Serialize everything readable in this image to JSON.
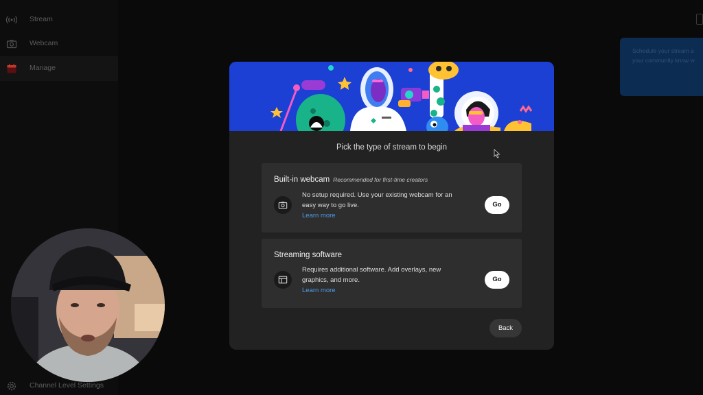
{
  "sidebar": {
    "items": [
      {
        "label": "Stream",
        "icon": "broadcast-icon"
      },
      {
        "label": "Webcam",
        "icon": "camera-icon"
      },
      {
        "label": "Manage",
        "icon": "calendar-icon"
      }
    ],
    "footer_label": "Channel Level Settings"
  },
  "promo": {
    "line1": "Schedule your stream a",
    "line2": "your community know w"
  },
  "modal": {
    "title": "Pick the type of stream to begin",
    "options": [
      {
        "title": "Built-in webcam",
        "tag": "Recommended for first-time creators",
        "desc_line1": "No setup required. Use your existing webcam for an",
        "desc_line2": "easy way to go live.",
        "link": "Learn more",
        "button": "Go",
        "icon": "camera-icon"
      },
      {
        "title": "Streaming software",
        "desc_line1": "Requires additional software. Add overlays, new",
        "desc_line2": "graphics, and more.",
        "link": "Learn more",
        "button": "Go",
        "icon": "layout-icon"
      }
    ],
    "back_label": "Back"
  },
  "colors": {
    "banner": "#1c3fd4",
    "link": "#4e9be8",
    "modal_bg": "#222222",
    "card_bg": "#2e2e2e"
  }
}
